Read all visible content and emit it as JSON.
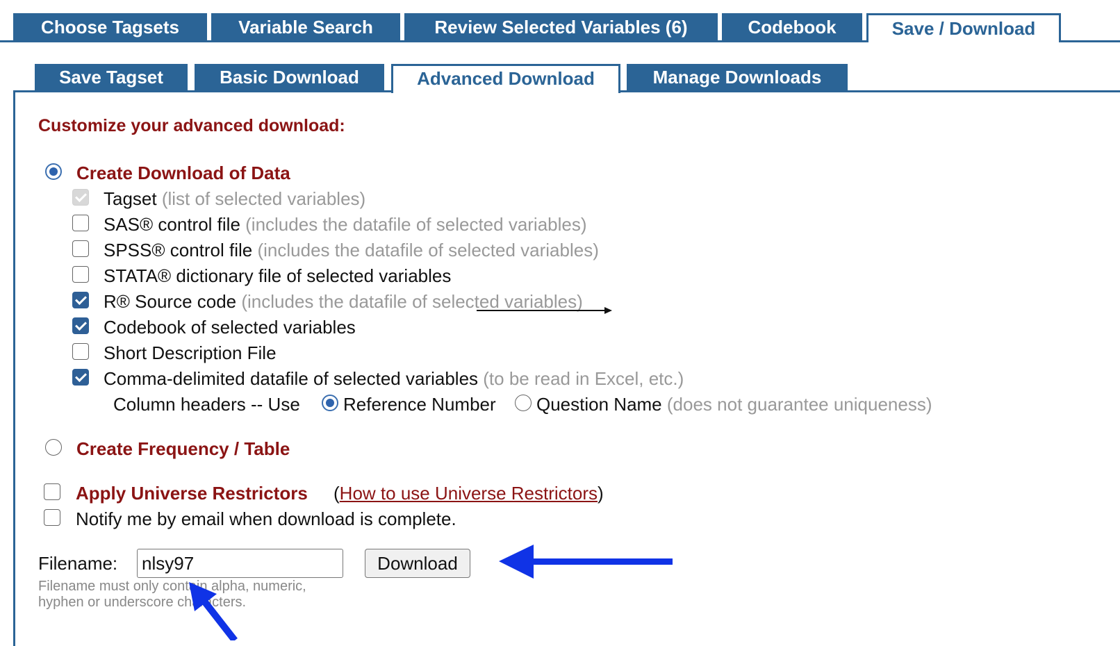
{
  "main_tabs": [
    {
      "label": "Choose Tagsets"
    },
    {
      "label": "Variable Search"
    },
    {
      "label": "Review Selected Variables (6)"
    },
    {
      "label": "Codebook"
    },
    {
      "label": "Save / Download",
      "active": true
    }
  ],
  "sub_tabs": [
    {
      "label": "Save Tagset"
    },
    {
      "label": "Basic Download"
    },
    {
      "label": "Advanced Download",
      "active": true
    },
    {
      "label": "Manage Downloads"
    }
  ],
  "content": {
    "heading": "Customize your advanced download:",
    "create_download": {
      "label": "Create Download of Data",
      "selected": true
    },
    "options": [
      {
        "label": "Tagset",
        "hint": "(list of selected variables)",
        "checked": true,
        "disabled": true
      },
      {
        "label": "SAS® control file",
        "hint": "(includes the datafile of selected variables)",
        "checked": false
      },
      {
        "label": "SPSS® control file",
        "hint": "(includes the datafile of selected variables)",
        "checked": false
      },
      {
        "label": "STATA® dictionary file of selected variables",
        "hint": "",
        "checked": false
      },
      {
        "label": "R® Source code",
        "hint": "(includes the datafile of selected variables)",
        "checked": true
      },
      {
        "label": "Codebook of selected variables",
        "hint": "",
        "checked": true
      },
      {
        "label": "Short Description File",
        "hint": "",
        "checked": false
      },
      {
        "label": "Comma-delimited datafile of selected variables",
        "hint": "(to be read in Excel, etc.)",
        "checked": true
      }
    ],
    "column_headers": {
      "label": "Column headers -- Use",
      "option_reference": "Reference Number",
      "option_question": "Question Name",
      "question_hint": "(does not guarantee uniqueness)",
      "selected": "Reference Number"
    },
    "create_frequency": {
      "label": "Create Frequency / Table",
      "selected": false
    },
    "universe": {
      "label": "Apply Universe Restrictors",
      "open_paren": "(",
      "link": "How to use Universe Restrictors",
      "close_paren": ")",
      "checked": false
    },
    "notify": {
      "label": "Notify me by email when download is complete.",
      "checked": false
    },
    "filename": {
      "label": "Filename:",
      "value": "nlsy97",
      "note_line1": "Filename must only contain alpha, numeric,",
      "note_line2": "hyphen or underscore characters."
    },
    "download_button": "Download"
  },
  "colors": {
    "tab_blue": "#2b6496",
    "heading_red": "#8b1414",
    "hint_gray": "#999999",
    "annotation_blue": "#1033e6"
  }
}
